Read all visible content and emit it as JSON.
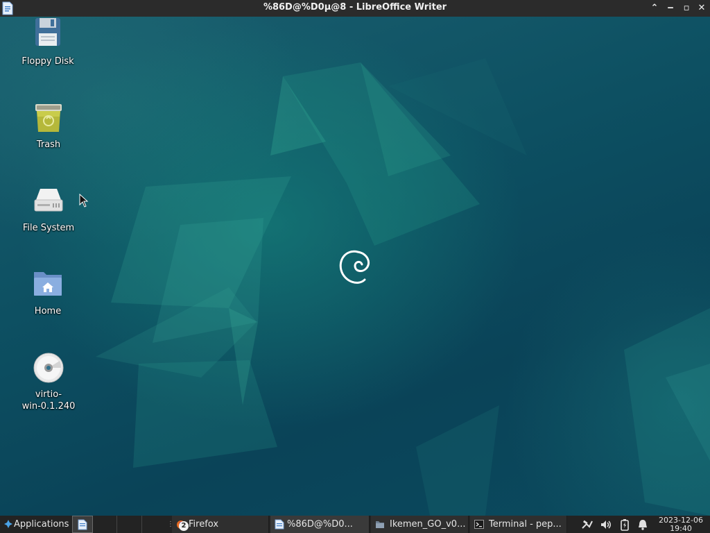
{
  "window": {
    "title": "%86D@%D0µ@8 - LibreOffice Writer",
    "app_icon": "writer-document-icon",
    "buttons": [
      "maximize-up-icon",
      "minimize-icon",
      "restore-icon",
      "close-icon"
    ],
    "button_glyphs": {
      "up": "⌃",
      "min": "‒",
      "restore": "▫",
      "close": "✕"
    }
  },
  "desktop": {
    "icons": [
      {
        "label": "Floppy Disk",
        "icon": "floppy-disk-icon"
      },
      {
        "label": "Trash",
        "icon": "trash-icon"
      },
      {
        "label": "File System",
        "icon": "hard-drive-icon"
      },
      {
        "label": "Home",
        "icon": "home-folder-icon"
      },
      {
        "label": "virtio-\nwin-0.1.240",
        "icon": "optical-disc-icon"
      }
    ],
    "wallpaper": "debian-swirl-teal"
  },
  "panel": {
    "applications_label": "Applications",
    "tasks": [
      {
        "label": "Firefox",
        "icon": "firefox-icon",
        "badge": "2"
      },
      {
        "label": "%86D@%D0...",
        "icon": "writer-document-icon",
        "active": true
      },
      {
        "label": "Ikemen_GO_v0...",
        "icon": "folder-icon"
      },
      {
        "label": "Terminal - pep...",
        "icon": "terminal-icon"
      }
    ],
    "tray": [
      "network-icon",
      "volume-icon",
      "battery-icon",
      "notification-bell-icon"
    ],
    "clock": {
      "date": "2023-12-06",
      "time": "19:40"
    }
  },
  "colors": {
    "panel_bg": "#232323",
    "titlebar_bg": "#2b2b2b",
    "wallpaper_base": "#0b4a5e",
    "wallpaper_accent": "#1f9a84"
  }
}
